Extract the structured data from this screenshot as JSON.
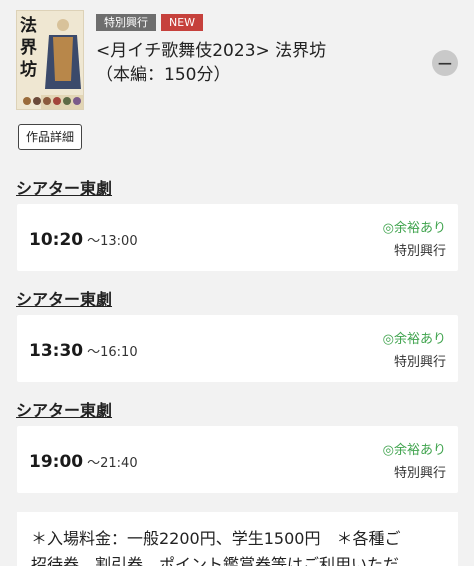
{
  "event": {
    "badges": [
      "特別興行",
      "NEW"
    ],
    "title_line1": "<月イチ歌舞伎2023> 法界坊",
    "title_line2": "（本編：150分）",
    "poster_text": "法界坊",
    "collapse_symbol": "−",
    "detail_label": "作品詳細"
  },
  "screenings": [
    {
      "theater": "シアター東劇",
      "start": "10:20",
      "end": "〜13:00",
      "availability": "◎余裕あり",
      "type": "特別興行"
    },
    {
      "theater": "シアター東劇",
      "start": "13:30",
      "end": "〜16:10",
      "availability": "◎余裕あり",
      "type": "特別興行"
    },
    {
      "theater": "シアター東劇",
      "start": "19:00",
      "end": "〜21:40",
      "availability": "◎余裕あり",
      "type": "特別興行"
    }
  ],
  "notice": {
    "line1": "＊入場料金：一般2200円、学生1500円　＊各種ご",
    "line2": "招待券、割引券、ポイント鑑賞券等はご利用いただ"
  },
  "colors": {
    "availability": "#3fa34d",
    "badge_new": "#c6413c",
    "badge_special": "#6e6e6e"
  }
}
